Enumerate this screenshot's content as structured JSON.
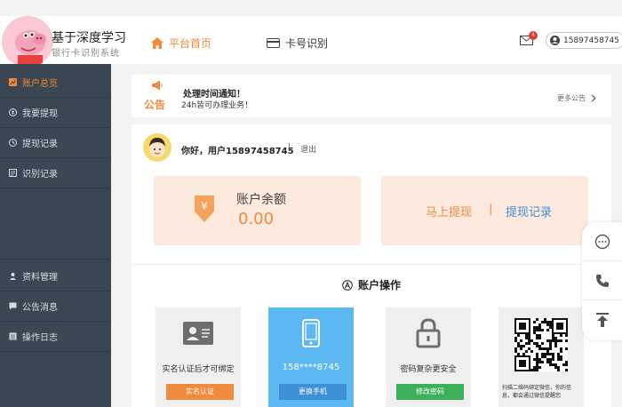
{
  "header": {
    "brand_title": "基于深度学习",
    "brand_subtitle": "银行卡识别系统",
    "nav": [
      {
        "label": "平台首页",
        "icon": "home-icon",
        "active": true
      },
      {
        "label": "卡号识别",
        "icon": "card-icon",
        "active": false
      }
    ],
    "mail_badge": "4",
    "username": "15897458745"
  },
  "sidebar": {
    "items": [
      {
        "label": "账户总览",
        "icon": "chart-icon",
        "active": true
      },
      {
        "label": "我要提现",
        "icon": "money-icon",
        "active": false
      },
      {
        "label": "提现记录",
        "icon": "history-icon",
        "active": false
      },
      {
        "label": "识别记录",
        "icon": "scan-icon",
        "active": false
      },
      {
        "label": "资料管理",
        "icon": "user-icon",
        "active": false
      },
      {
        "label": "公告消息",
        "icon": "message-icon",
        "active": false
      },
      {
        "label": "操作日志",
        "icon": "log-icon",
        "active": false
      }
    ]
  },
  "notice": {
    "label": "公告",
    "title": "处理时间通知！",
    "text": "24h皆可办理业务！",
    "more": "更多公告"
  },
  "account": {
    "greeting": "你好，用户15897458745",
    "separator": "|",
    "logout": "退出",
    "balance_label": "账户余额",
    "balance_value": "0.00",
    "withdraw_now": "马上提现",
    "withdraw_sep": "|",
    "withdraw_records": "提现记录"
  },
  "operations": {
    "title": "账户操作",
    "items": [
      {
        "text": "实名认证后才可绑定",
        "button": "实名认证",
        "color": "#f08a3c",
        "icon": "id-card-icon"
      },
      {
        "text": "158****8745",
        "button": "更换手机",
        "color": "#3d8fd6",
        "icon": "phone-icon"
      },
      {
        "text": "密码复杂更安全",
        "button": "修改密码",
        "color": "#3cb15a",
        "icon": "lock-icon"
      },
      {
        "text": "扫描二维码绑定微信，你的信息，都会通过微信提醒您",
        "button": "",
        "color": "#ffffff",
        "icon": "qrcode-icon"
      }
    ]
  },
  "colors": {
    "accent": "#f08a3c",
    "sidebar_bg": "#3a4651",
    "blue": "#3d8fd6",
    "green": "#3cb15a"
  }
}
